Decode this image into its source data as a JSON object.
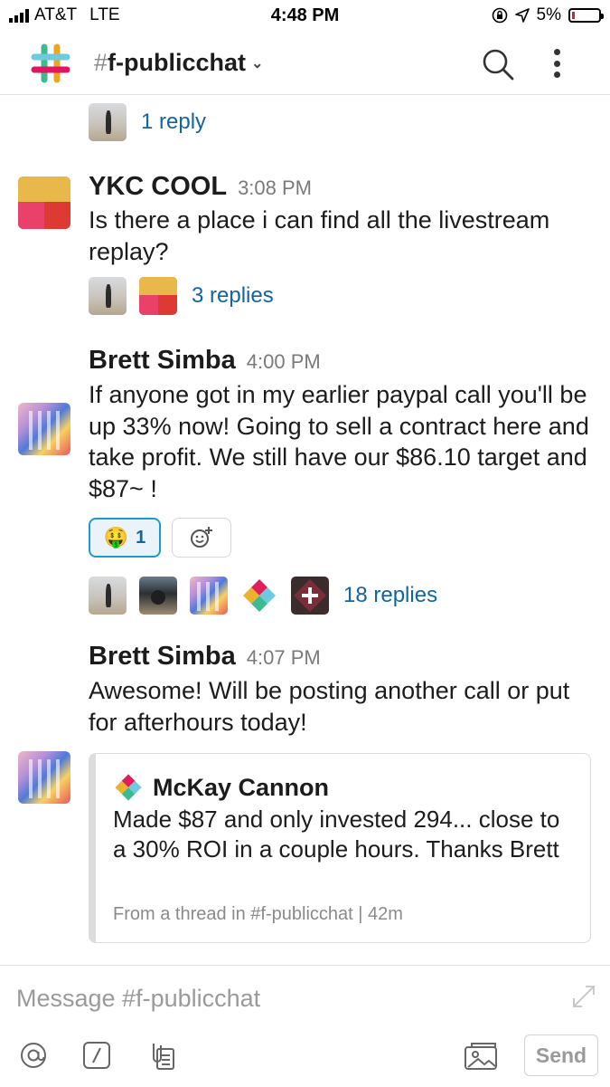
{
  "status_bar": {
    "carrier": "AT&T",
    "network": "LTE",
    "time": "4:48 PM",
    "battery": "5%",
    "icons": [
      "signal-icon",
      "lock-rotation-icon",
      "location-arrow-icon",
      "battery-icon"
    ]
  },
  "header": {
    "hash": "#",
    "channel": "f-publicchat",
    "icons": [
      "slack-logo-icon",
      "chevron-down-icon",
      "search-icon",
      "more-vertical-icon"
    ]
  },
  "messages": [
    {
      "thread_replies": "1 reply"
    },
    {
      "author": "YKC COOL",
      "time": "3:08 PM",
      "text": "Is there a place i can find all the livestream replay?",
      "thread_replies": "3 replies"
    },
    {
      "author": "Brett Simba",
      "time": "4:00 PM",
      "text": "If anyone got in my earlier paypal call you'll be up 33% now! Going to sell a contract here and take profit. We still have our $86.10 target and $87~ !",
      "reaction": {
        "emoji": "🤑",
        "count": "1"
      },
      "thread_replies": "18 replies"
    },
    {
      "author": "Brett Simba",
      "time": "4:07 PM",
      "text": "Awesome! Will be posting another call or put for afterhours today!",
      "attachment": {
        "author": "McKay Cannon",
        "text": "Made $87 and only invested 294... close to a 30% ROI in a couple hours. Thanks Brett",
        "footer": "From a thread in #f-publicchat | 42m"
      }
    }
  ],
  "composer": {
    "placeholder": "Message #f-publicchat",
    "send_label": "Send",
    "icons": [
      "mention-icon",
      "slash-command-icon",
      "file-icon",
      "image-icon",
      "expand-icon"
    ]
  },
  "colors": {
    "link": "#1264a3",
    "reaction_border": "#1d9bd1",
    "reaction_bg": "#eaf3fa",
    "text": "#1d1c1d",
    "muted": "#7a7a7a"
  }
}
